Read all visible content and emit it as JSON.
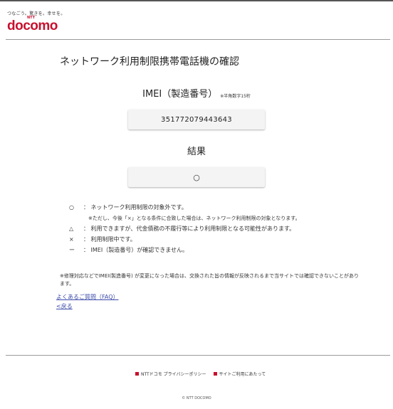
{
  "header": {
    "tagline": "つなごう。驚きを。幸せを。",
    "logo_ntt": "NTT",
    "logo_text": "docomo"
  },
  "page": {
    "title": "ネットワーク利用制限携帯電話機の確認"
  },
  "imei": {
    "label": "IMEI（製造番号）",
    "note": "※半角数字15桁",
    "value": "351772079443643"
  },
  "result": {
    "label": "結果",
    "value": "○"
  },
  "legend": {
    "items": [
      {
        "symbol": "○",
        "text": "：  ネットワーク利用制限の対象外です。"
      },
      {
        "symbol": "",
        "text": "※ただし、今後「×」となる条件に合致した場合は、ネットワーク利用制限の対象となります。"
      },
      {
        "symbol": "△",
        "text": "：  利用できますが、代金債務の不履行等により利用制限となる可能性があります。"
      },
      {
        "symbol": "×",
        "text": "：  利用制限中です。"
      },
      {
        "symbol": "ー",
        "text": "：  IMEI（製造番号）が確認できません。"
      }
    ]
  },
  "footnote": "※修理対応などでIMEI(製造番号) が変更になった場合は、交換された旨の情報が反映されるまで当サイトでは確認できないことがあります。",
  "links": {
    "faq": "よくあるご質問（FAQ）",
    "back": "<戻る"
  },
  "footer": {
    "privacy": "NTTドコモ プライバシーポリシー",
    "terms": "サイトご利用にあたって",
    "copyright": "© NTT DOCOMO"
  },
  "colors": {
    "brand": "#c8102e",
    "link": "#3b4aa8"
  }
}
